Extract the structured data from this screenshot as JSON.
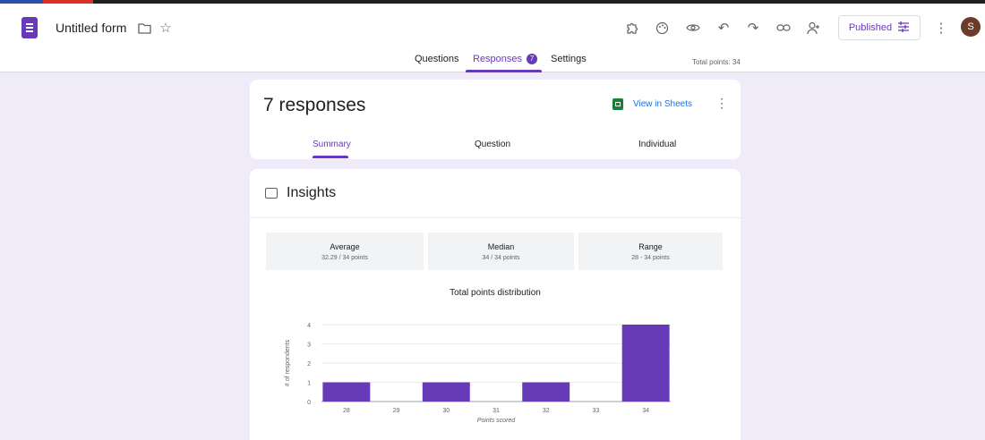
{
  "header": {
    "title": "Untitled form",
    "publish_label": "Published",
    "avatar_letter": "S",
    "icons": [
      "folder-icon",
      "star-icon",
      "addon-icon",
      "palette-icon",
      "preview-icon",
      "undo-icon",
      "redo-icon",
      "link-icon",
      "add-collaborator-icon",
      "tune-icon",
      "more-vert-icon"
    ]
  },
  "tabs": {
    "questions": "Questions",
    "responses": "Responses",
    "responses_count": "7",
    "settings": "Settings",
    "total_points": "Total points: 34"
  },
  "summary_card": {
    "title": "7 responses",
    "view_in_sheets": "View in Sheets",
    "subtabs": [
      "Summary",
      "Question",
      "Individual"
    ]
  },
  "insights": {
    "title": "Insights",
    "stats": [
      {
        "label": "Average",
        "value": "32.29 / 34 points"
      },
      {
        "label": "Median",
        "value": "34 / 34 points"
      },
      {
        "label": "Range",
        "value": "28 - 34 points"
      }
    ]
  },
  "chart_data": {
    "type": "bar",
    "title": "Total points distribution",
    "categories": [
      "28",
      "29",
      "30",
      "31",
      "32",
      "33",
      "34"
    ],
    "values": [
      1,
      0,
      1,
      0,
      1,
      0,
      4
    ],
    "xlabel": "Points scored",
    "ylabel": "# of respondents",
    "yticks": [
      "0",
      "1",
      "2",
      "3",
      "4"
    ],
    "ylim": [
      0,
      4
    ],
    "bar_color": "#673ab7",
    "grid": true
  },
  "colors": {
    "accent": "#673ab7",
    "background": "#f0ebf8",
    "link": "#1a73e8",
    "sheets": "#188038"
  }
}
